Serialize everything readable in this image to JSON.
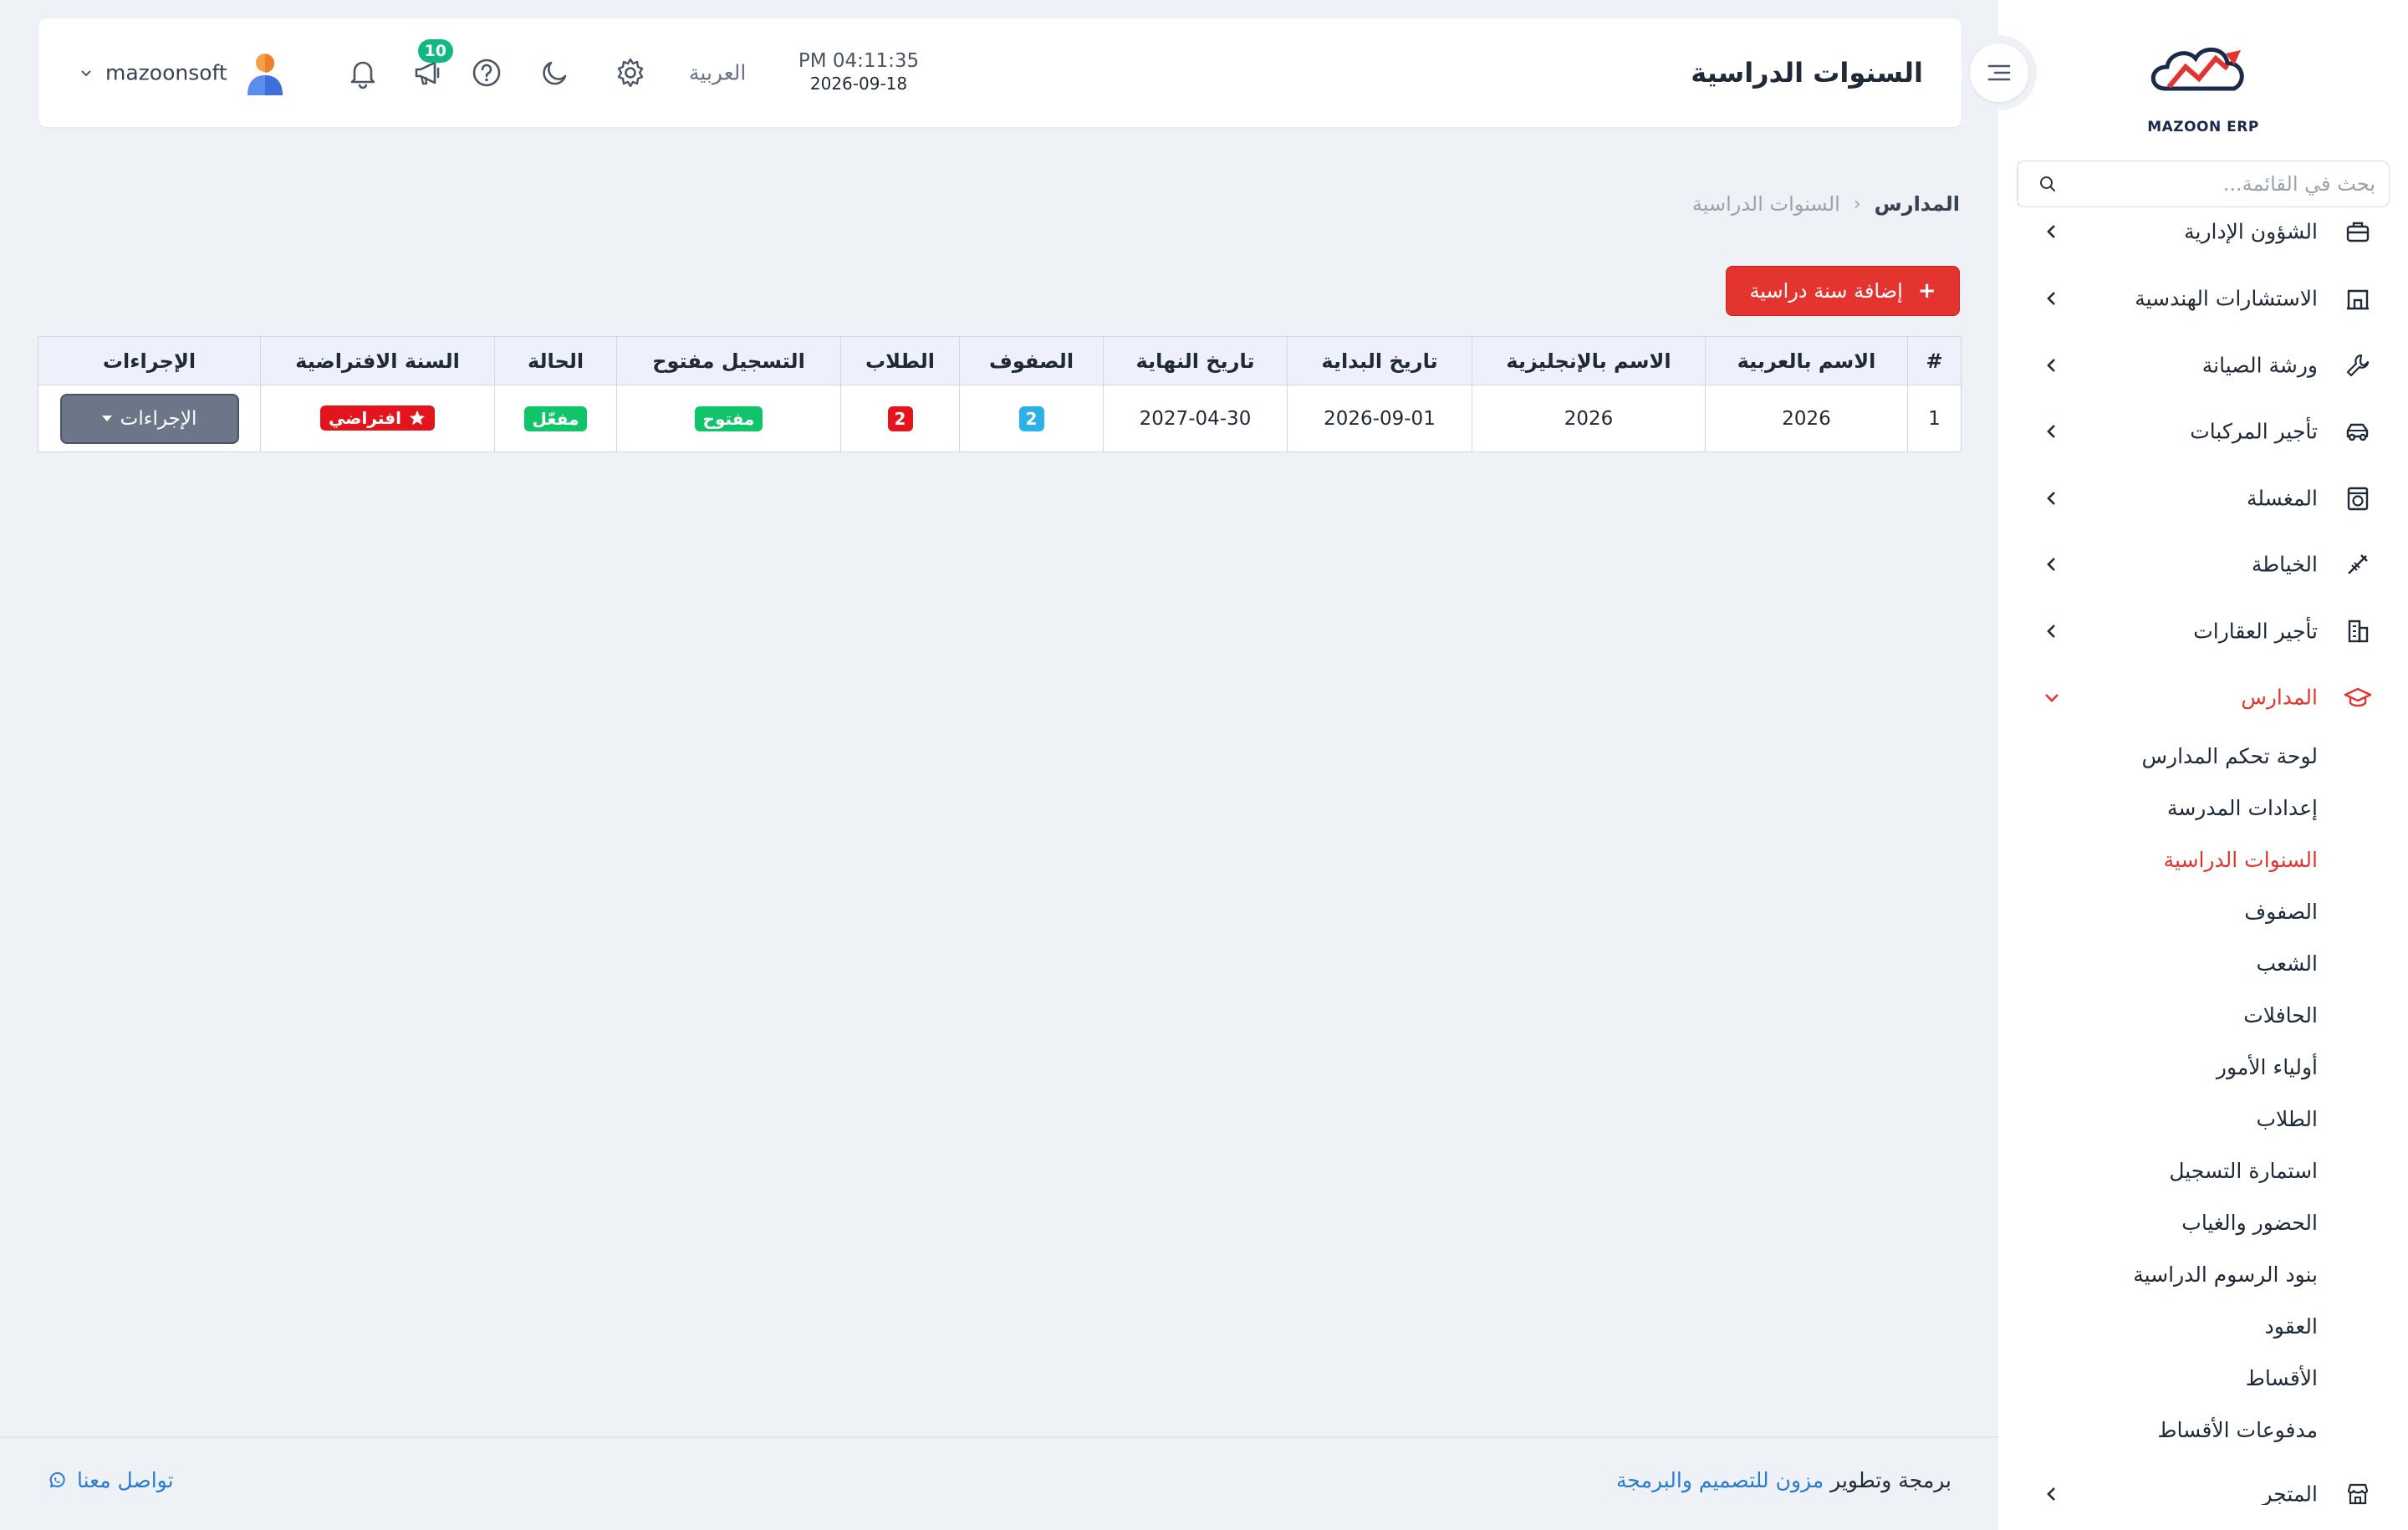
{
  "header": {
    "title": "السنوات الدراسية",
    "time": "PM 04:11:35",
    "date": "2026-09-18",
    "language": "العربية",
    "notifications_count": "10",
    "username": "mazoonsoft"
  },
  "sidebar": {
    "logo_text": "MAZOON ERP",
    "search_placeholder": "بحث في القائمة...",
    "items": [
      {
        "label": "الشؤون الإدارية",
        "icon": "briefcase-icon"
      },
      {
        "label": "الاستشارات الهندسية",
        "icon": "building-icon"
      },
      {
        "label": "ورشة الصيانة",
        "icon": "wrench-icon"
      },
      {
        "label": "تأجير المركبات",
        "icon": "car-icon"
      },
      {
        "label": "المغسلة",
        "icon": "washer-icon"
      },
      {
        "label": "الخياطة",
        "icon": "sewing-icon"
      },
      {
        "label": "تأجير العقارات",
        "icon": "office-building-icon"
      },
      {
        "label": "المدارس",
        "icon": "graduation-cap-icon"
      },
      {
        "label": "المتجر",
        "icon": "store-icon"
      }
    ],
    "schools_sub": [
      "لوحة تحكم المدارس",
      "إعدادات المدرسة",
      "السنوات الدراسية",
      "الصفوف",
      "الشعب",
      "الحافلات",
      "أولياء الأمور",
      "الطلاب",
      "استمارة التسجيل",
      "الحضور والغياب",
      "بنود الرسوم الدراسية",
      "العقود",
      "الأقساط",
      "مدفوعات الأقساط"
    ]
  },
  "breadcrumb": {
    "root": "المدارس",
    "current": "السنوات الدراسية"
  },
  "add_button": "إضافة سنة دراسية",
  "table": {
    "columns": [
      "#",
      "الاسم بالعربية",
      "الاسم بالإنجليزية",
      "تاريخ البداية",
      "تاريخ النهاية",
      "الصفوف",
      "الطلاب",
      "التسجيل مفتوح",
      "الحالة",
      "السنة الافتراضية",
      "الإجراءات"
    ],
    "rows": [
      {
        "index": "1",
        "name_ar": "2026",
        "name_en": "2026",
        "start_date": "2026-09-01",
        "end_date": "2027-04-30",
        "classes": "2",
        "students": "2",
        "registration": "مفتوح",
        "status": "مفعّل",
        "default": "افتراضي",
        "actions": "الإجراءات"
      }
    ]
  },
  "footer": {
    "prefix": "برمجة وتطوير",
    "company": "مزون للتصميم والبرمجة",
    "contact": "تواصل معنا"
  },
  "colors": {
    "accent": "#e3342f",
    "info": "#2bb1e6",
    "success": "#10c46a",
    "link": "#2b7bd0"
  }
}
